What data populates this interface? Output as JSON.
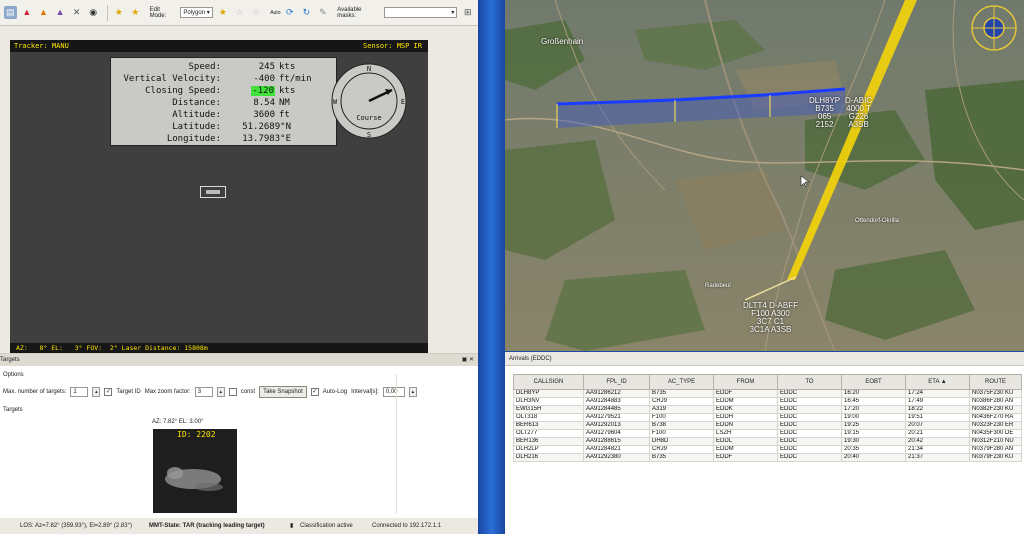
{
  "toolbar": {
    "edit_mode_label": "Edit Mode:",
    "edit_mode_value": "Polygon",
    "auto_label": "Auto",
    "available_masks_label": "Available masks:",
    "available_masks_value": ""
  },
  "video": {
    "tracker": "Tracker: MANU",
    "sensor": "Sensor: MSP IR",
    "bottom_info": "AZ:   8° EL:   3° FOV:  2° Laser Distance: 15808m",
    "hud": {
      "speed_label": "Speed:",
      "speed_value": "245",
      "speed_unit": "kts",
      "vvel_label": "Vertical Velocity:",
      "vvel_value": "-400",
      "vvel_unit": "ft/min",
      "closing_label": "Closing Speed:",
      "closing_value": "-120",
      "closing_unit": "kts",
      "distance_label": "Distance:",
      "distance_value": "8.54",
      "distance_unit": "NM",
      "altitude_label": "Altitude:",
      "altitude_value": "3600",
      "altitude_unit": "ft",
      "lat_label": "Latitude:",
      "lat_value": "51.2689°N",
      "lon_label": "Longitude:",
      "lon_value": "13.7983°E"
    },
    "compass": {
      "n": "N",
      "e": "E",
      "s": "S",
      "w": "W",
      "label": "Course"
    }
  },
  "targets_panel": {
    "title": "Targets",
    "options_label": "Options",
    "max_targets_label": "Max. number of targets:",
    "max_targets_value": "1",
    "target_id_label": "Target ID",
    "max_zoom_label": "Max zoom factor:",
    "max_zoom_value": "3",
    "const_label": "const",
    "snapshot_button": "Take Snapshot",
    "autolog_label": "Auto-Log",
    "interval_label": "Interval[s]:",
    "interval_value": "0,00",
    "targets_label": "Targets",
    "thumb_meta": "AZ: 7.82° EL: 3.00°",
    "thumb_id": "ID: 2202"
  },
  "status": {
    "los": "LOS: Az=7.82° (359.93°), El=2.89° (2.83°)",
    "mmt_state": "MMT-State: TAR (tracking leading target)",
    "classification": "Classification active",
    "connection": "Connected to 192.172.1.1"
  },
  "map": {
    "label_groebenhain": "Großenhain",
    "label_radebeul": "Radebeul",
    "label_otl": "Ottendorf-Okrilla",
    "track_dlh8yp": "DLH8YP\nB735\n065\n2152",
    "track_dabic": "D-ABIC\n4000 T\nG226\nA3SB",
    "cluster": "DLTT4 D-ABFF\nF100 A300\n3C7 C1\n3C1A A3SB"
  },
  "arrivals": {
    "title": "Arrivals (EDDC)",
    "columns": [
      "CALLSIGN",
      "FPL_ID",
      "AC_TYPE",
      "FROM",
      "TO",
      "EOBT",
      "ETA ▲",
      "ROUTE"
    ],
    "rows": [
      [
        "DLH8YP",
        "AA91286212",
        "B735",
        "EDDF",
        "EDDC",
        "16:20",
        "17:24",
        "N0375F230 KU"
      ],
      [
        "DLH3NV",
        "AA91284883",
        "CRJ9",
        "EDDM",
        "EDDC",
        "16:45",
        "17:49",
        "N0386F280 AN"
      ],
      [
        "EWG15H",
        "AA91284485",
        "A319",
        "EDDK",
        "EDDC",
        "17:20",
        "18:22",
        "N0382F230 KU"
      ],
      [
        "OLT318",
        "AA91279521",
        "F100",
        "EDDH",
        "EDDC",
        "19:00",
        "19:51",
        "N0436F270 RA"
      ],
      [
        "BER613",
        "AA91292013",
        "B738",
        "EDDN",
        "EDDC",
        "19:25",
        "20:07",
        "N0323F230 ER"
      ],
      [
        "OLT277",
        "AA91279604",
        "F100",
        "LSZH",
        "EDDC",
        "19:15",
        "20:21",
        "N0435F300 DE"
      ],
      [
        "BER136",
        "AA91288615",
        "DH8D",
        "EDDL",
        "EDDC",
        "19:30",
        "20:42",
        "N0312F210 NU"
      ],
      [
        "DLH2LP",
        "AA91284821",
        "CRJ9",
        "EDDM",
        "EDDC",
        "20:35",
        "21:34",
        "N0379F280 AN"
      ],
      [
        "DLH216",
        "AA91292380",
        "B735",
        "EDDF",
        "EDDC",
        "20:40",
        "21:37",
        "N0379F230 KU"
      ]
    ]
  },
  "colors": {
    "hud_yellow": "#ffe600",
    "highlight_green": "#3fe23a",
    "track_blue": "#1a3cff",
    "beam_yellow": "#f5d40a",
    "desktop_blue": "#1b4ea0"
  }
}
